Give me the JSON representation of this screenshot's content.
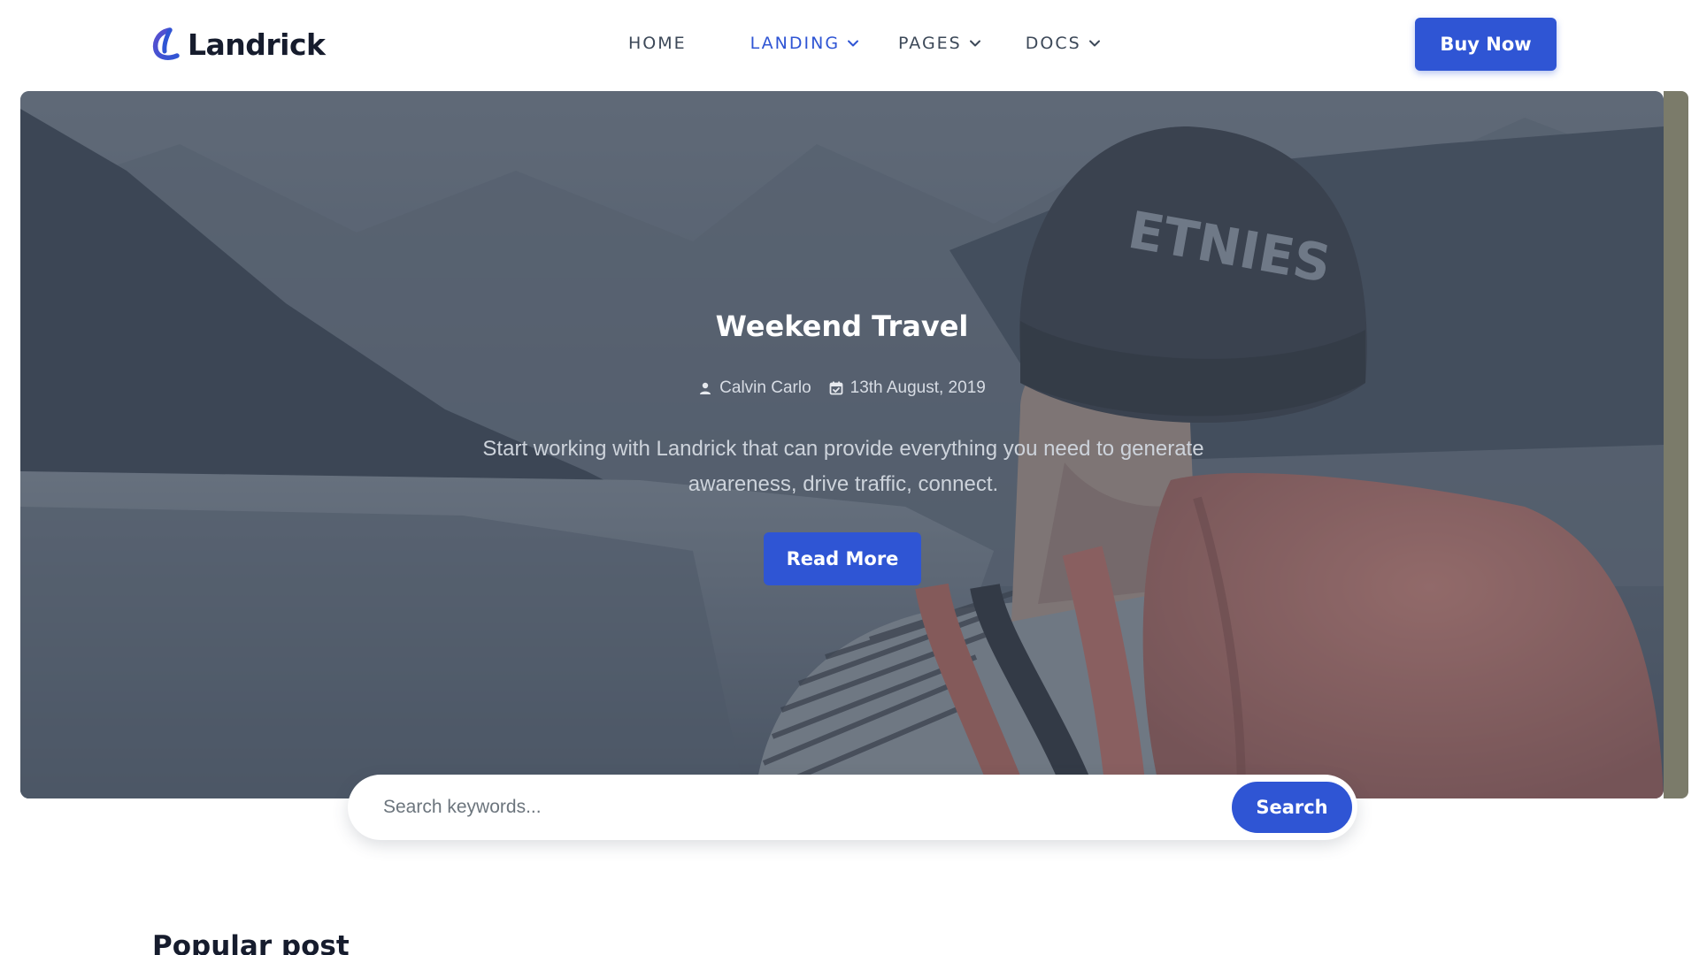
{
  "brand": {
    "name": "Landrick",
    "accent": "#2f55d4"
  },
  "nav": {
    "items": [
      {
        "label": "HOME",
        "active": false,
        "has_dropdown": false
      },
      {
        "label": "LANDING",
        "active": true,
        "has_dropdown": true
      },
      {
        "label": "PAGES",
        "active": false,
        "has_dropdown": true
      },
      {
        "label": "DOCS",
        "active": false,
        "has_dropdown": true
      }
    ],
    "cta_label": "Buy Now"
  },
  "hero": {
    "title": "Weekend Travel",
    "author": "Calvin Carlo",
    "date": "13th August, 2019",
    "description": "Start working with Landrick that can provide everything you need to generate awareness, drive traffic, connect.",
    "button_label": "Read More",
    "author_icon": "user-icon",
    "date_icon": "calendar-check-icon"
  },
  "search": {
    "placeholder": "Search keywords...",
    "value": "",
    "button_label": "Search"
  },
  "sections": {
    "popular_title": "Popular post"
  }
}
